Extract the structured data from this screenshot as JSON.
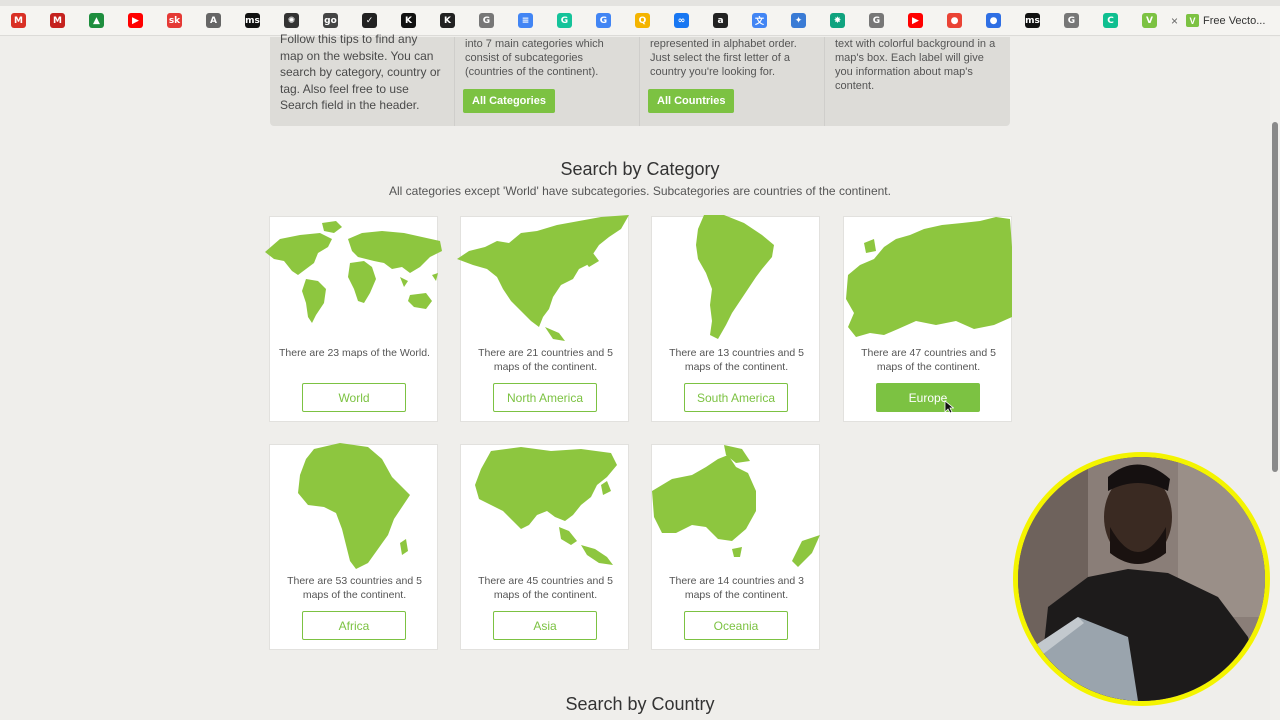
{
  "bookmarks": [
    {
      "name": "gmail-icon",
      "letter": "M",
      "color": "#d93025"
    },
    {
      "name": "gmail-icon-2",
      "letter": "M",
      "color": "#c5221f"
    },
    {
      "name": "drive-icon",
      "letter": "▲",
      "color": "#1e8e3e"
    },
    {
      "name": "youtube-icon",
      "letter": "▶",
      "color": "#ff0000"
    },
    {
      "name": "sk-icon",
      "letter": "sk",
      "color": "#e53935"
    },
    {
      "name": "a-icon",
      "letter": "A",
      "color": "#666666"
    },
    {
      "name": "ms-icon",
      "letter": "ms",
      "color": "#111111"
    },
    {
      "name": "openai-icon",
      "letter": "✺",
      "color": "#333333"
    },
    {
      "name": "go-icon",
      "letter": "go",
      "color": "#444444"
    },
    {
      "name": "nike-icon",
      "letter": "✓",
      "color": "#222222"
    },
    {
      "name": "k-icon",
      "letter": "K",
      "color": "#111111"
    },
    {
      "name": "k-icon-2",
      "letter": "K",
      "color": "#222222"
    },
    {
      "name": "g-icon",
      "letter": "G",
      "color": "#777777"
    },
    {
      "name": "docs-icon",
      "letter": "≡",
      "color": "#4285f4"
    },
    {
      "name": "grammarly-icon",
      "letter": "G",
      "color": "#15c39a"
    },
    {
      "name": "google-icon",
      "letter": "G",
      "color": "#4285f4"
    },
    {
      "name": "search-icon",
      "letter": "Q",
      "color": "#f4b400"
    },
    {
      "name": "meta-icon",
      "letter": "∞",
      "color": "#1877f2"
    },
    {
      "name": "amazon-icon",
      "letter": "a",
      "color": "#222222"
    },
    {
      "name": "translate-icon",
      "letter": "文",
      "color": "#4285f4"
    },
    {
      "name": "shield-icon",
      "letter": "✦",
      "color": "#3a7bd5"
    },
    {
      "name": "chatgpt-icon",
      "letter": "✸",
      "color": "#10a37f"
    },
    {
      "name": "g-icon-2",
      "letter": "G",
      "color": "#777777"
    },
    {
      "name": "youtube-icon-2",
      "letter": "▶",
      "color": "#ff0000"
    },
    {
      "name": "maps-pin-icon",
      "letter": "●",
      "color": "#ea4335"
    },
    {
      "name": "globe-icon",
      "letter": "●",
      "color": "#2f6fe4"
    },
    {
      "name": "ms-icon-2",
      "letter": "ms",
      "color": "#111111"
    },
    {
      "name": "g-icon-3",
      "letter": "G",
      "color": "#777777"
    },
    {
      "name": "canva-icon",
      "letter": "C",
      "color": "#0fbf90"
    },
    {
      "name": "v-icon",
      "letter": "V",
      "color": "#7cc242"
    }
  ],
  "active_tab": {
    "label": "Free Vecto..."
  },
  "tips": [
    {
      "text": "Follow this tips to find any map on the website. You can search by category, country or tag. Also feel free to use Search field in the header."
    },
    {
      "text": "into 7 main categories which consist of subcategories (countries of the continent).",
      "button": "All Categories"
    },
    {
      "text": "represented in alphabet order. Just select the first letter of a country you're looking for.",
      "button": "All Countries"
    },
    {
      "text": "text with colorful background in a map's box. Each label will give you information about map's content."
    }
  ],
  "category_section": {
    "title": "Search by Category",
    "subtitle": "All categories except 'World' have subcategories. Subcategories are countries of the continent."
  },
  "categories": [
    {
      "name": "World",
      "description": "There are 23 maps of the World.",
      "active": false
    },
    {
      "name": "North America",
      "description": "There are 21 countries and 5 maps of the continent.",
      "active": false
    },
    {
      "name": "South America",
      "description": "There are 13 countries and 5 maps of the continent.",
      "active": false
    },
    {
      "name": "Europe",
      "description": "There are 47 countries and 5 maps of the continent.",
      "active": true
    },
    {
      "name": "Africa",
      "description": "There are 53 countries and 5 maps of the continent.",
      "active": false
    },
    {
      "name": "Asia",
      "description": "There are 45 countries and 5 maps of the continent.",
      "active": false
    },
    {
      "name": "Oceania",
      "description": "There are 14 countries and 3 maps of the continent.",
      "active": false
    }
  ],
  "country_section": {
    "title": "Search by Country"
  },
  "colors": {
    "accent": "#7cc242",
    "map_fill": "#8dc63f",
    "webcam_ring": "#f4f400"
  }
}
